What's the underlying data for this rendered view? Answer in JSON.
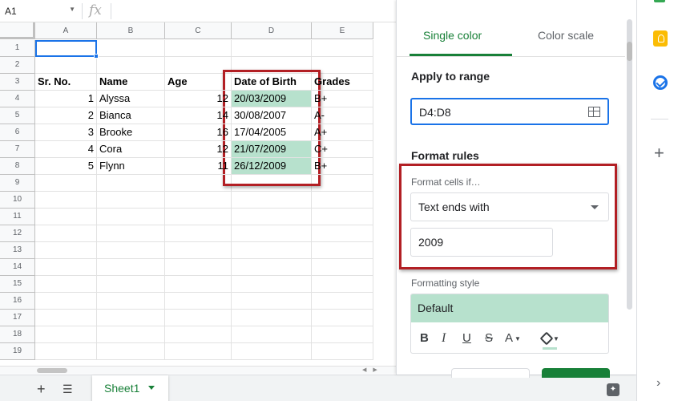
{
  "formula_bar": {
    "name_box": "A1",
    "fx": "fx"
  },
  "columns": [
    "A",
    "B",
    "C",
    "D",
    "E"
  ],
  "rows": [
    "1",
    "2",
    "3",
    "4",
    "5",
    "6",
    "7",
    "8",
    "9",
    "10",
    "11",
    "12",
    "13",
    "14",
    "15",
    "16",
    "17",
    "18",
    "19"
  ],
  "cells": [
    {
      "col": 0,
      "row": 2,
      "text": "Sr. No.",
      "bold": true
    },
    {
      "col": 1,
      "row": 2,
      "text": "Name",
      "bold": true
    },
    {
      "col": 2,
      "row": 2,
      "text": "Age",
      "bold": true
    },
    {
      "col": 3,
      "row": 2,
      "text": "Date of Birth",
      "bold": true
    },
    {
      "col": 4,
      "row": 2,
      "text": "Grades",
      "bold": true
    },
    {
      "col": 0,
      "row": 3,
      "text": "1",
      "align": "right"
    },
    {
      "col": 1,
      "row": 3,
      "text": "Alyssa"
    },
    {
      "col": 2,
      "row": 3,
      "text": "12",
      "align": "right"
    },
    {
      "col": 3,
      "row": 3,
      "text": "20/03/2009",
      "highlight": true
    },
    {
      "col": 4,
      "row": 3,
      "text": "B+"
    },
    {
      "col": 0,
      "row": 4,
      "text": "2",
      "align": "right"
    },
    {
      "col": 1,
      "row": 4,
      "text": "Bianca"
    },
    {
      "col": 2,
      "row": 4,
      "text": "14",
      "align": "right"
    },
    {
      "col": 3,
      "row": 4,
      "text": "30/08/2007"
    },
    {
      "col": 4,
      "row": 4,
      "text": "A-"
    },
    {
      "col": 0,
      "row": 5,
      "text": "3",
      "align": "right"
    },
    {
      "col": 1,
      "row": 5,
      "text": "Brooke"
    },
    {
      "col": 2,
      "row": 5,
      "text": "16",
      "align": "right"
    },
    {
      "col": 3,
      "row": 5,
      "text": "17/04/2005"
    },
    {
      "col": 4,
      "row": 5,
      "text": "A+"
    },
    {
      "col": 0,
      "row": 6,
      "text": "4",
      "align": "right"
    },
    {
      "col": 1,
      "row": 6,
      "text": "Cora"
    },
    {
      "col": 2,
      "row": 6,
      "text": "12",
      "align": "right"
    },
    {
      "col": 3,
      "row": 6,
      "text": "21/07/2009",
      "highlight": true
    },
    {
      "col": 4,
      "row": 6,
      "text": "C+"
    },
    {
      "col": 0,
      "row": 7,
      "text": "5",
      "align": "right"
    },
    {
      "col": 1,
      "row": 7,
      "text": "Flynn"
    },
    {
      "col": 2,
      "row": 7,
      "text": "11",
      "align": "right"
    },
    {
      "col": 3,
      "row": 7,
      "text": "26/12/2009",
      "highlight": true
    },
    {
      "col": 4,
      "row": 7,
      "text": "B+"
    }
  ],
  "sheet_tabs": {
    "active": "Sheet1"
  },
  "panel": {
    "tabs": {
      "single_color": "Single color",
      "color_scale": "Color scale"
    },
    "apply_to_range_label": "Apply to range",
    "range_value": "D4:D8",
    "format_rules_label": "Format rules",
    "format_cells_if_label": "Format cells if…",
    "condition": "Text ends with",
    "condition_value": "2009",
    "formatting_style_label": "Formatting style",
    "style_preview": "Default",
    "toolbar": {
      "bold": "B",
      "italic": "I",
      "underline": "U",
      "strikethrough": "S",
      "text_color": "A"
    }
  },
  "colors": {
    "accent_green": "#188038",
    "highlight": "#b7e1cd",
    "selection_blue": "#1a73e8",
    "annotation_red": "#b21f24"
  }
}
